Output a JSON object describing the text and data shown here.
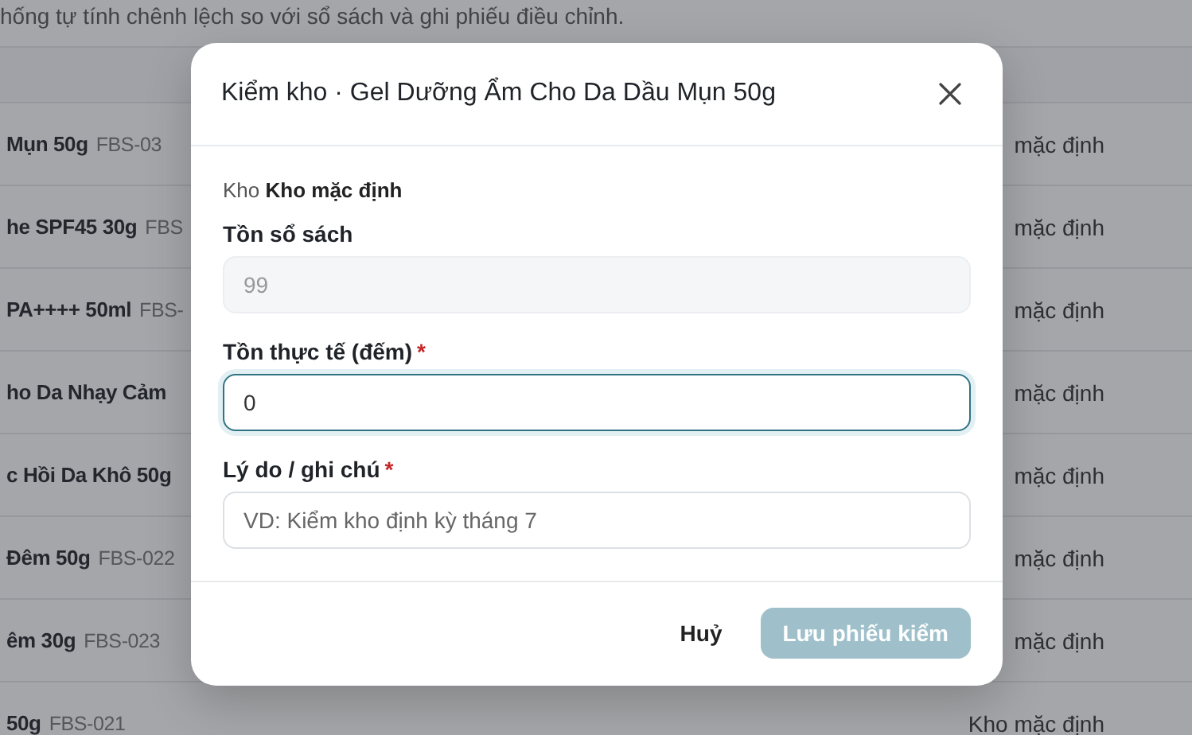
{
  "page": {
    "description": "hống tự tính chênh lệch so với sổ sách và ghi phiếu điều chỉnh.",
    "rows": [
      {
        "name": "Mụn 50g",
        "sku": "FBS-03",
        "warehouse": "mặc định"
      },
      {
        "name": "he SPF45 30g",
        "sku": "FBS",
        "warehouse": "mặc định"
      },
      {
        "name": "PA++++ 50ml",
        "sku": "FBS-",
        "warehouse": "mặc định"
      },
      {
        "name": "ho Da Nhạy Cảm",
        "sku": "",
        "warehouse": "mặc định"
      },
      {
        "name": "c Hồi Da Khô 50g",
        "sku": "",
        "warehouse": "mặc định"
      },
      {
        "name": "Đêm 50g",
        "sku": "FBS-022",
        "warehouse": "mặc định"
      },
      {
        "name": "êm 30g",
        "sku": "FBS-023",
        "warehouse": "mặc định"
      },
      {
        "name": "50g",
        "sku": "FBS-021",
        "warehouse": "Kho mặc định"
      }
    ]
  },
  "dialog": {
    "title": "Kiểm kho · Gel Dưỡng Ẩm Cho Da Dầu Mụn 50g",
    "warehouse_label": "Kho",
    "warehouse": "Kho mặc định",
    "fields": [
      {
        "label": "Tồn sổ sách",
        "value": "99",
        "disabled": true,
        "focused": false
      },
      {
        "label": "Tồn thực tế (đếm)",
        "required_mark": "*",
        "value": "0",
        "disabled": false,
        "focused": true
      },
      {
        "label": "Lý do / ghi chú",
        "required_mark": "*",
        "placeholder": "VD: Kiểm kho định kỳ tháng 7",
        "disabled": false,
        "focused": false
      }
    ],
    "buttons": [
      {
        "label": "Huỷ",
        "kind": "secondary",
        "disabled": false
      },
      {
        "label": "Lưu phiếu kiểm",
        "kind": "primary",
        "disabled": true
      }
    ]
  }
}
